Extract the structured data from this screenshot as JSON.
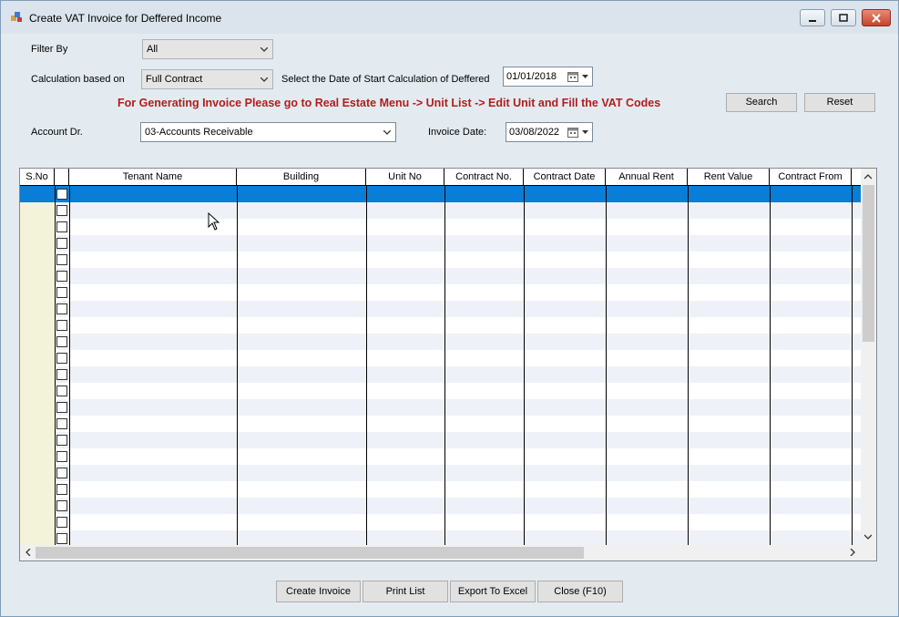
{
  "window": {
    "title": "Create VAT Invoice for Deffered Income",
    "icons": {
      "app": "app-icon",
      "minimize": "minimize-icon",
      "maximize": "maximize-icon",
      "close": "close-icon"
    }
  },
  "filters": {
    "filter_by_label": "Filter By",
    "filter_by_value": "All",
    "calc_label": "Calculation based on",
    "calc_value": "Full Contract",
    "start_date_label": "Select the Date of Start Calculation of Deffered",
    "start_date_value": "01/01/2018",
    "account_label": "Account Dr.",
    "account_value": "03-Accounts Receivable",
    "invoice_date_label": "Invoice Date:",
    "invoice_date_value": "03/08/2022"
  },
  "notice": "For Generating Invoice Please go to Real Estate Menu -> Unit List -> Edit Unit and Fill the VAT Codes",
  "buttons": {
    "search": "Search",
    "reset": "Reset",
    "create_invoice": "Create Invoice",
    "print_list": "Print List",
    "export_excel": "Export To Excel",
    "close": "Close (F10)"
  },
  "grid": {
    "columns": [
      "S.No",
      "",
      "Tenant Name",
      "Building",
      "Unit No",
      "Contract No.",
      "Contract Date",
      "Annual Rent",
      "Rent Value",
      "Contract From"
    ],
    "selected_row_index": 0
  },
  "colors": {
    "notice": "#b21d1d",
    "selection": "#0a7dd6",
    "sno_column": "#f3f3da"
  }
}
